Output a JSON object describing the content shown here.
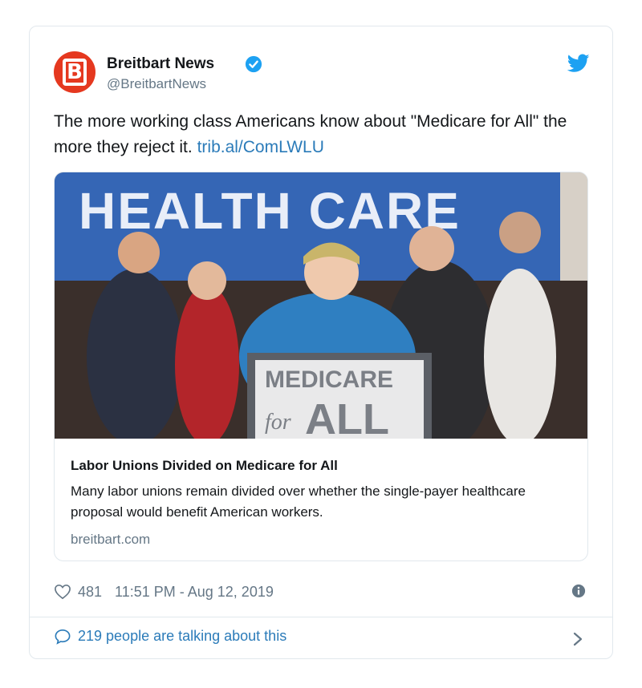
{
  "tweet": {
    "author_name": "Breitbart News",
    "author_handle": "@BreitbartNews",
    "avatar_letter": "B",
    "text": "The more working class Americans know about \"Medicare for All\" the more they reject it.",
    "link_text": "trib.al/ComLWLU",
    "likes": "481",
    "timestamp": "11:51 PM - Aug 12, 2019",
    "talking": "219 people are talking about this"
  },
  "card": {
    "banner_text": "HEALTH CARE",
    "podium_line1": "MEDICARE",
    "podium_for": "for",
    "podium_line2": "ALL",
    "title": "Labor Unions Divided on Medicare for All",
    "description": "Many labor unions remain divided over whether the single-payer healthcare proposal would benefit American workers.",
    "domain": "breitbart.com"
  },
  "icons": {
    "verified": "verified-badge-icon",
    "bird": "twitter-bird-icon",
    "heart": "heart-icon",
    "info": "info-icon",
    "bubble": "speech-bubble-icon",
    "chevron": "chevron-right-icon"
  },
  "colors": {
    "brand_red": "#e5381f",
    "link_blue": "#2b7bb9",
    "twitter_blue": "#1da1f2",
    "muted": "#657786",
    "border": "#e1e8ed"
  }
}
